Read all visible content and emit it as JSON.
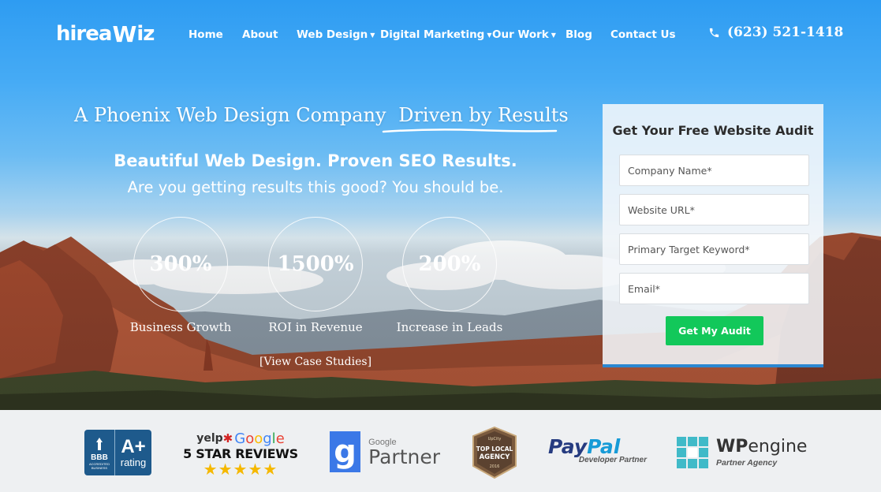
{
  "brand": {
    "logo_text_left": "hirea",
    "logo_text_mid": "W",
    "logo_text_right": "iz"
  },
  "nav": {
    "items": [
      {
        "label": "Home",
        "dropdown": false
      },
      {
        "label": "About",
        "dropdown": false
      },
      {
        "label": "Web Design",
        "dropdown": true
      },
      {
        "label": "Digital Marketing",
        "dropdown": true
      },
      {
        "label": "Our Work",
        "dropdown": true
      },
      {
        "label": "Blog",
        "dropdown": false
      },
      {
        "label": "Contact Us",
        "dropdown": false
      }
    ],
    "phone": "(623) 521-1418"
  },
  "hero": {
    "headline_main": "A Phoenix Web Design Company",
    "headline_accent": "Driven by Results",
    "subheadline": "Beautiful Web Design. Proven SEO Results.",
    "tagline": "Are you getting results this good? You should be.",
    "stats": [
      {
        "value": "300%",
        "label": "Business Growth"
      },
      {
        "value": "1500%",
        "label": "ROI in Revenue"
      },
      {
        "value": "200%",
        "label": "Increase in Leads"
      }
    ],
    "case_studies_link": "[View Case Studies]"
  },
  "form": {
    "title": "Get Your Free Website Audit",
    "fields": [
      {
        "placeholder": "Company Name*",
        "value": ""
      },
      {
        "placeholder": "Website URL*",
        "value": ""
      },
      {
        "placeholder": "Primary Target Keyword*",
        "value": ""
      },
      {
        "placeholder": "Email*",
        "value": ""
      }
    ],
    "submit_label": "Get My Audit",
    "submit_color": "#12c85a"
  },
  "badges": {
    "bbb": {
      "letters": "BBB",
      "accredited": "ACCREDITED BUSINESS",
      "grade": "A+",
      "rating": "rating"
    },
    "yelp_google": {
      "yelp": "yelp",
      "google": "Google",
      "reviews": "5 STAR REVIEWS",
      "stars": "★★★★★"
    },
    "google_partner": {
      "g": "g",
      "google": "Google",
      "partner": "Partner"
    },
    "top_local_agency": {
      "line1": "TOP LOCAL",
      "line2": "AGENCY",
      "top": "UpCity",
      "year": "2016"
    },
    "paypal": {
      "pay": "Pay",
      "pal": "Pal",
      "sub": "Developer Partner"
    },
    "wpengine": {
      "wp": "WP",
      "engine": "engine",
      "sub": "Partner Agency"
    }
  }
}
